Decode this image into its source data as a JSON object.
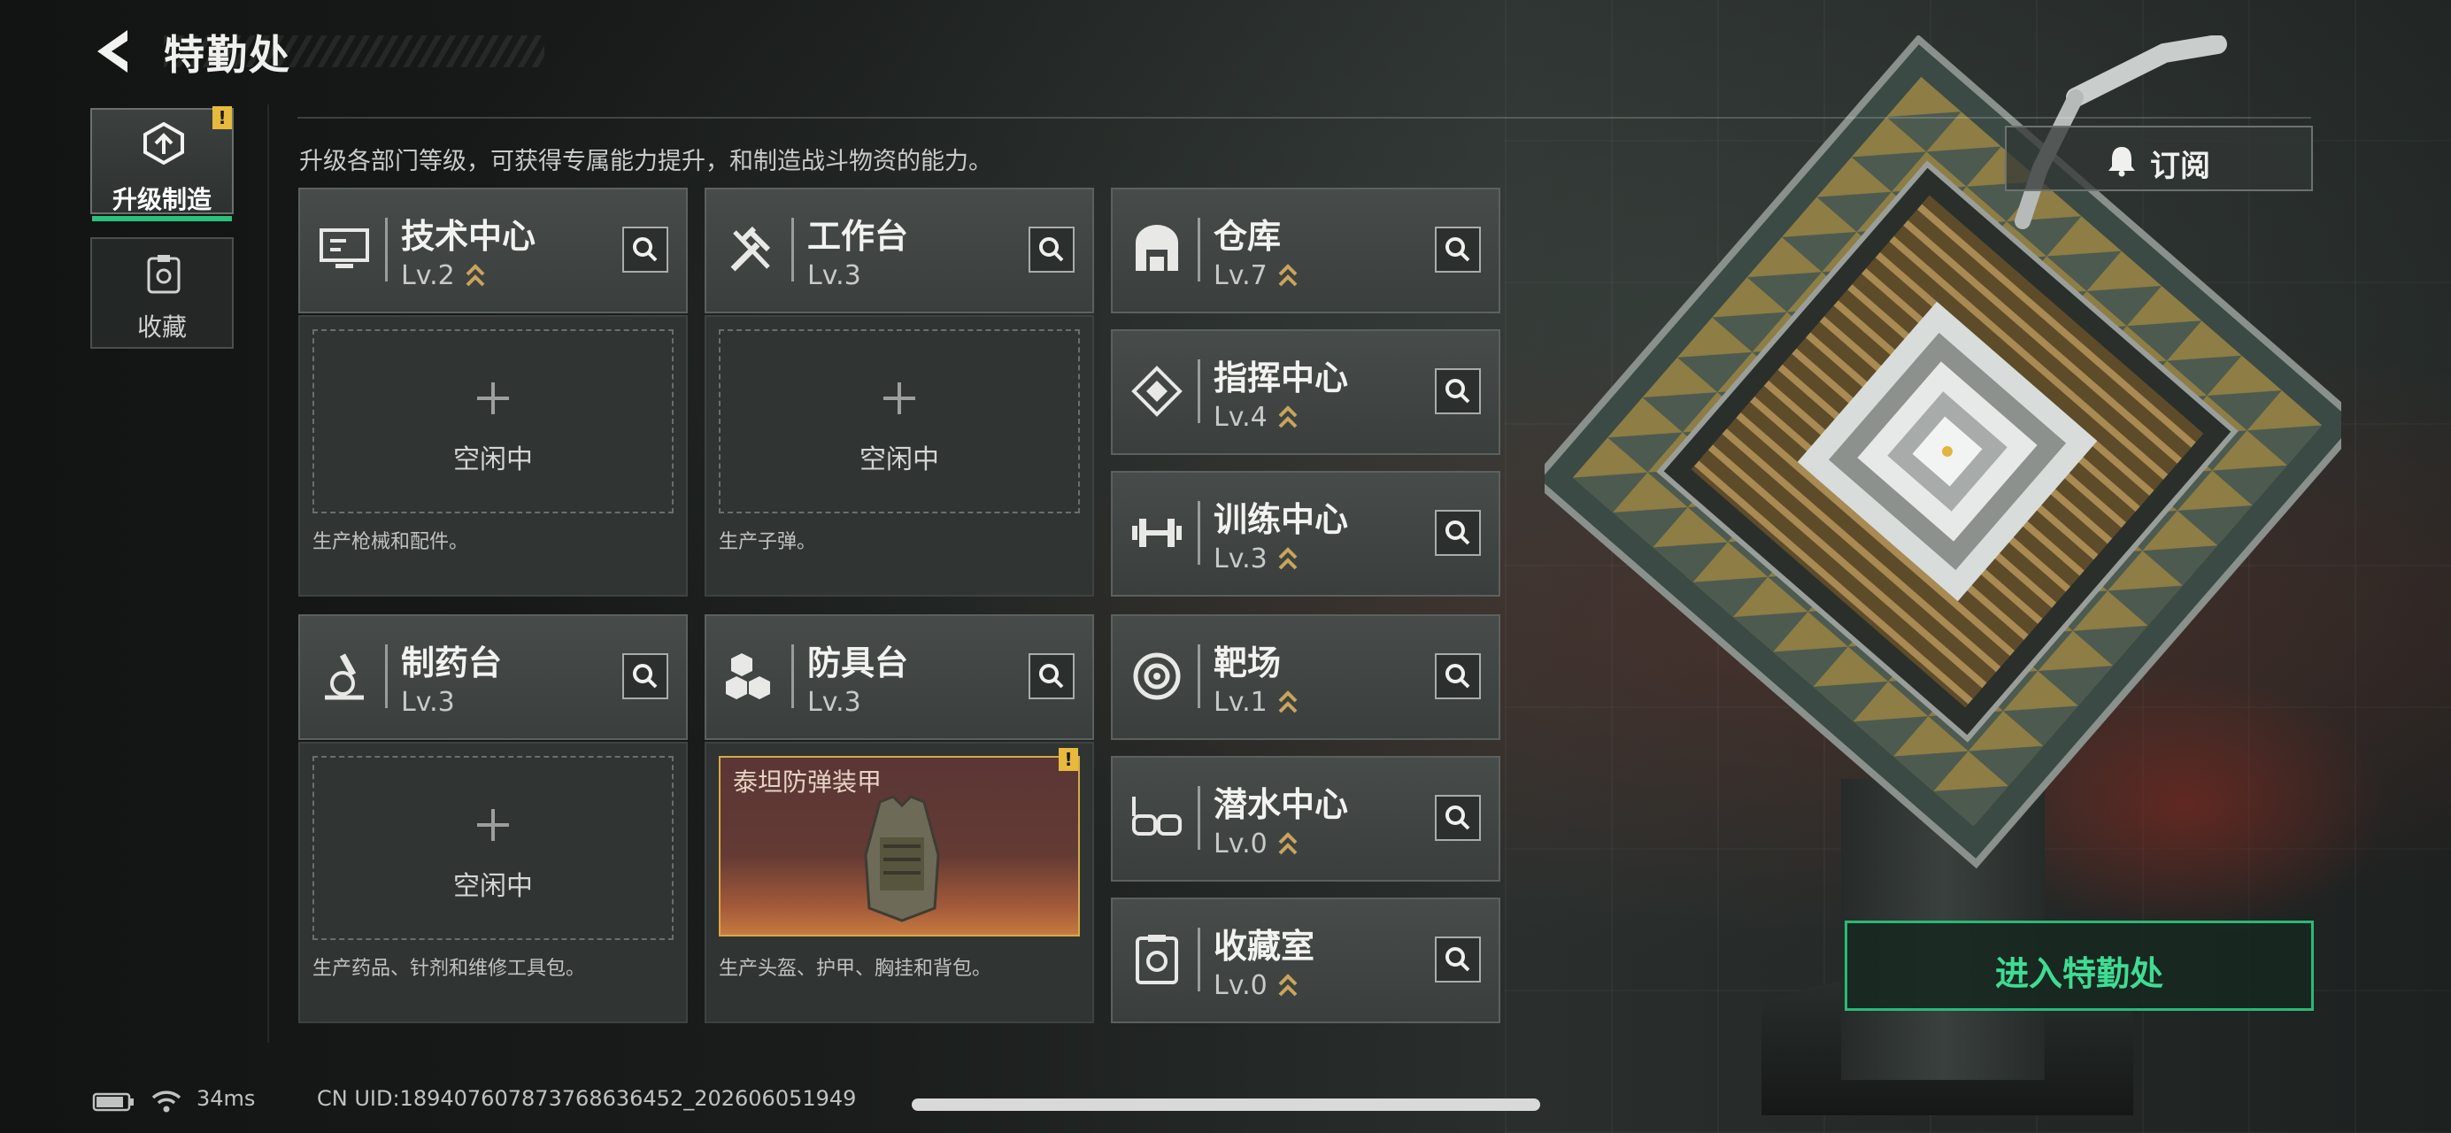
{
  "header": {
    "title": "特勤处"
  },
  "tabs": [
    {
      "label": "升级制造",
      "active": true,
      "alert": "!"
    },
    {
      "label": "收藏",
      "active": false
    }
  ],
  "subtitle": "升级各部门等级，可获得专属能力提升，和制造战斗物资的能力。",
  "stations": [
    {
      "name": "技术中心",
      "level": "Lv.2",
      "icon": "monitor-icon",
      "slot": {
        "state": "空闲中",
        "desc": "生产枪械和配件。"
      }
    },
    {
      "name": "工作台",
      "level": "Lv.3",
      "icon": "tools-icon",
      "slot": {
        "state": "空闲中",
        "desc": "生产子弹。"
      }
    },
    {
      "name": "制药台",
      "level": "Lv.3",
      "icon": "microscope-icon",
      "slot": {
        "state": "空闲中",
        "desc": "生产药品、针剂和维修工具包。"
      }
    },
    {
      "name": "防具台",
      "level": "Lv.3",
      "icon": "cubes-icon",
      "slot": {
        "item": "泰坦防弹装甲",
        "alert": "!",
        "desc": "生产头盔、护甲、胸挂和背包。"
      }
    }
  ],
  "facilities": [
    {
      "name": "仓库",
      "level": "Lv.7",
      "icon": "warehouse-icon"
    },
    {
      "name": "指挥中心",
      "level": "Lv.4",
      "icon": "command-icon"
    },
    {
      "name": "训练中心",
      "level": "Lv.3",
      "icon": "dumbbell-icon"
    },
    {
      "name": "靶场",
      "level": "Lv.1",
      "icon": "target-icon"
    },
    {
      "name": "潜水中心",
      "level": "Lv.0",
      "icon": "goggles-icon"
    },
    {
      "name": "收藏室",
      "level": "Lv.0",
      "icon": "collection-icon"
    }
  ],
  "subscribe": {
    "label": "订阅"
  },
  "enter_button": {
    "label": "进入特勤处"
  },
  "status_bar": {
    "ping": "34ms",
    "uid": "CN UID:18940760787376863645​2_202606051949"
  },
  "colors": {
    "accent_green": "#29c27d",
    "alert_yellow": "#e7b93c",
    "level_chevron": "#c9a45a"
  }
}
